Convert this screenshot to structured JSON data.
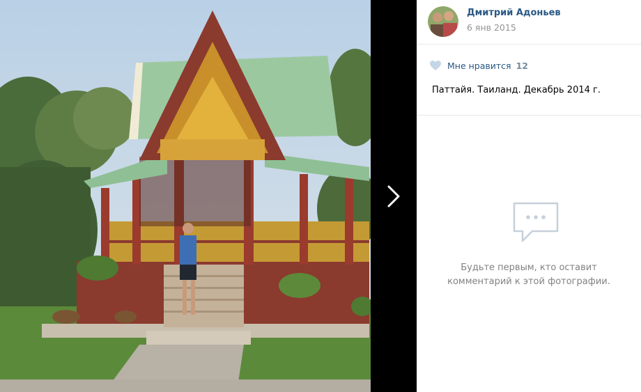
{
  "author": {
    "name": "Дмитрий Адоньев",
    "date": "6 янв 2015"
  },
  "likes": {
    "label": "Мне нравится",
    "count": "12"
  },
  "caption": "Паттайя. Таиланд. Декабрь 2014 г.",
  "comments": {
    "empty_line1": "Будьте первым, кто оставит",
    "empty_line2": "комментарий к этой фотографии."
  },
  "icons": {
    "next": "chevron-right-icon",
    "like": "heart-icon",
    "empty": "speech-bubble-icon"
  },
  "colors": {
    "link": "#2a5885",
    "muted": "#939393",
    "like_count": "#768c9e",
    "empty_text": "#828282",
    "divider": "#e7e8ec"
  }
}
